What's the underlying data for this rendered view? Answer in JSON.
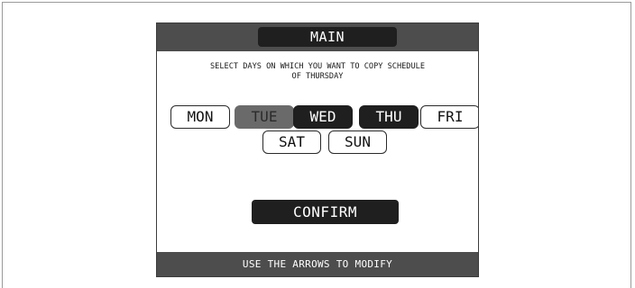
{
  "header": {
    "title": "MAIN"
  },
  "instruction": {
    "text": "SELECT DAYS ON WHICH YOU WANT TO COPY SCHEDULE\nOF THURSDAY"
  },
  "days": [
    {
      "label": "MON",
      "state": "unselected"
    },
    {
      "label": "TUE",
      "state": "disabled"
    },
    {
      "label": "WED",
      "state": "selected"
    },
    {
      "label": "THU",
      "state": "selected"
    },
    {
      "label": "FRI",
      "state": "unselected"
    },
    {
      "label": "SAT",
      "state": "unselected"
    },
    {
      "label": "SUN",
      "state": "unselected"
    }
  ],
  "confirm_label": "CONFIRM",
  "footer": {
    "hint": "USE THE ARROWS TO MODIFY"
  },
  "colors": {
    "bar_gray": "#4d4d4d",
    "selected_dark": "#1f1f1f",
    "disabled_gray": "#6a6a6a"
  }
}
